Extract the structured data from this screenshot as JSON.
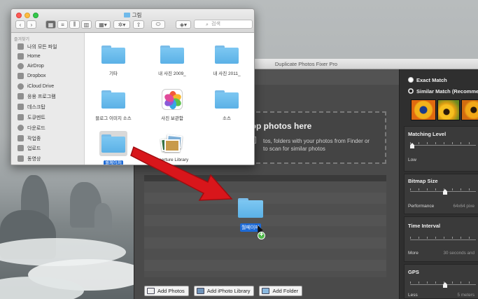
{
  "finder": {
    "title": "그림",
    "search_placeholder": "검색",
    "sidebar_header": "즐겨찾기",
    "sidebar_items": [
      "나의 모든 파일",
      "Home",
      "AirDrop",
      "Dropbox",
      "iCloud Drive",
      "응용 프로그램",
      "데스크탑",
      "도큐멘트",
      "다운로드",
      "작업중",
      "업로드",
      "동영상"
    ],
    "items": [
      "기타",
      "내 사진 2009_",
      "내 사진 2011_",
      "블로그 이미지 소스",
      "사진 보관함",
      "소스",
      "월페이퍼",
      "Aperture Library"
    ]
  },
  "app": {
    "title": "Duplicate Photos Fixer Pro",
    "drop_title": "rop photos here",
    "drop_sub": "tos, folders with your photos from Finder or\nto scan for similar photos",
    "buttons": [
      "Add Photos",
      "Add iPhoto Library",
      "Add Folder"
    ],
    "exact_match": "Exact Match",
    "similar_match": "Similar Match (Recomme",
    "matching_level": "Matching Level",
    "matching_level_value": "Low",
    "bitmap_size": "Bitmap Size",
    "bitmap_performance": "Performance",
    "bitmap_value": "64x64 pixe",
    "time_interval": "Time Interval",
    "time_more": "More",
    "time_value": "30 seconds and",
    "gps": "GPS",
    "gps_less": "Less",
    "gps_value": "5 meters"
  },
  "drag": {
    "label": "월페이퍼",
    "plus": "+"
  },
  "colors": {
    "accent_select": "#1d6ad6",
    "folder": "#5bb1e6",
    "arrow": "#d8161b",
    "add_badge": "#4fb84a"
  }
}
